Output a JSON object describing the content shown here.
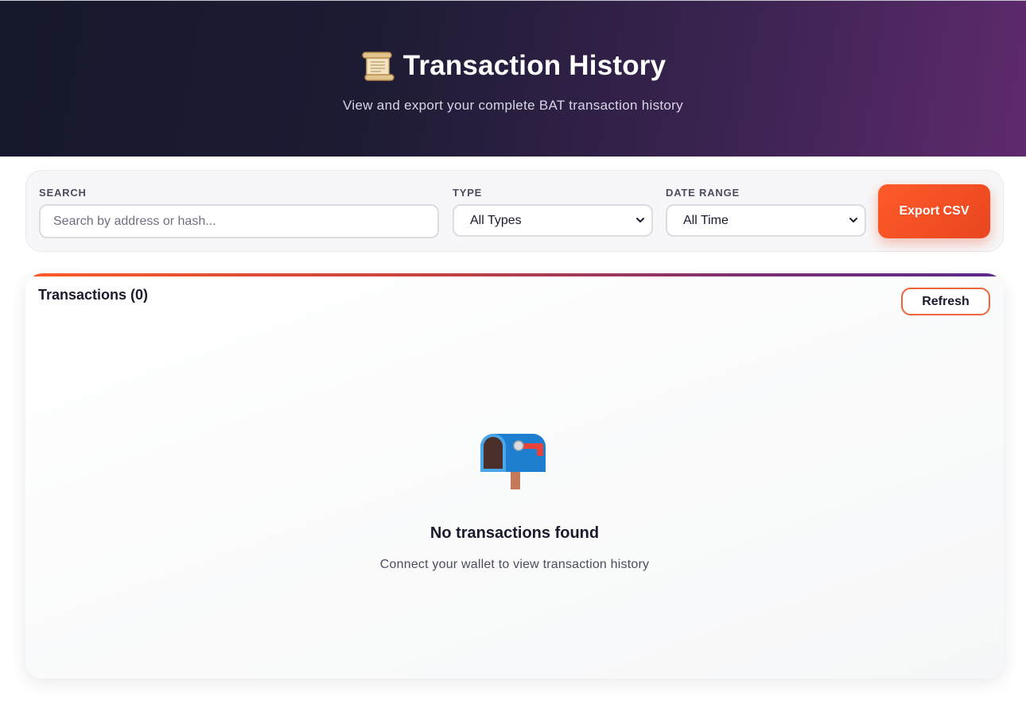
{
  "header": {
    "icon": "scroll-icon",
    "title": "Transaction History",
    "subtitle": "View and export your complete BAT transaction history"
  },
  "filters": {
    "search": {
      "label": "SEARCH",
      "placeholder": "Search by address or hash...",
      "value": ""
    },
    "type": {
      "label": "TYPE",
      "selected": "All Types"
    },
    "date_range": {
      "label": "DATE RANGE",
      "selected": "All Time"
    },
    "export_label": "Export CSV"
  },
  "transactions": {
    "title": "Transactions (0)",
    "refresh_label": "Refresh",
    "empty": {
      "icon": "mailbox-icon",
      "title": "No transactions found",
      "message": "Connect your wallet to view transaction history"
    }
  },
  "colors": {
    "accent": "#ff5a2a",
    "hero_start": "#16182b",
    "hero_end": "#5f2a6e"
  }
}
